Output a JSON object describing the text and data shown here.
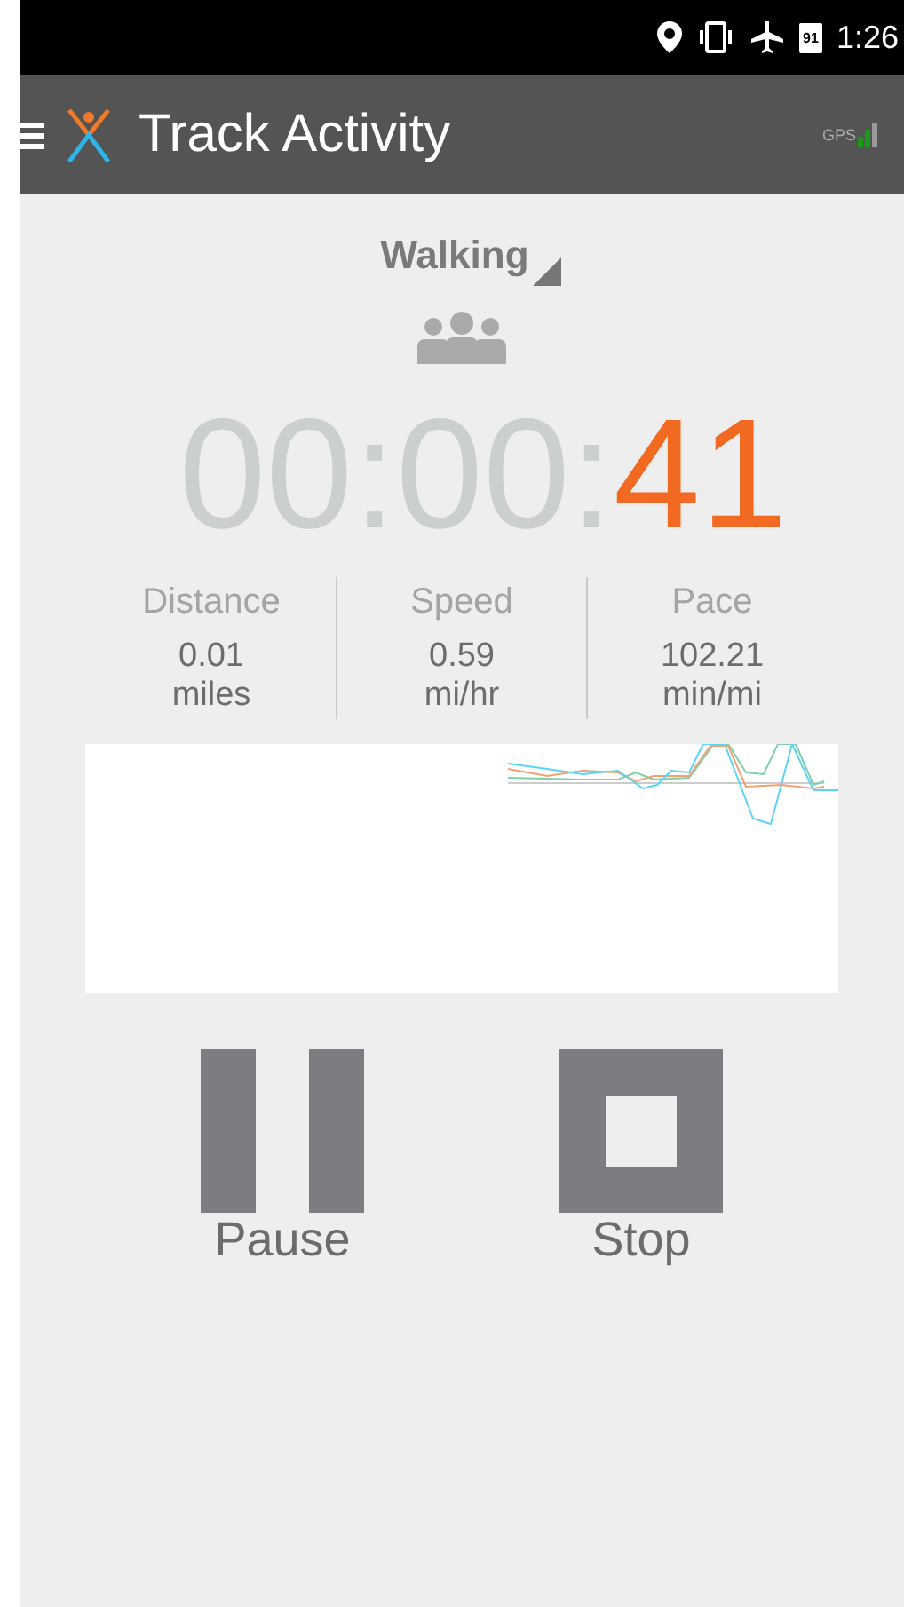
{
  "status_bar": {
    "time": "1:26",
    "battery": "91"
  },
  "app_bar": {
    "title": "Track Activity",
    "gps_label": "GPS"
  },
  "activity": {
    "type": "Walking"
  },
  "timer": {
    "elapsed": "00:00:",
    "seconds": "41"
  },
  "stats": [
    {
      "label": "Distance",
      "value": "0.01",
      "unit": "miles"
    },
    {
      "label": "Speed",
      "value": "0.59",
      "unit": "mi/hr"
    },
    {
      "label": "Pace",
      "value": "102.21",
      "unit": "min/mi"
    }
  ],
  "controls": [
    {
      "kind": "pause",
      "label": "Pause"
    },
    {
      "kind": "stop",
      "label": "Stop"
    }
  ]
}
